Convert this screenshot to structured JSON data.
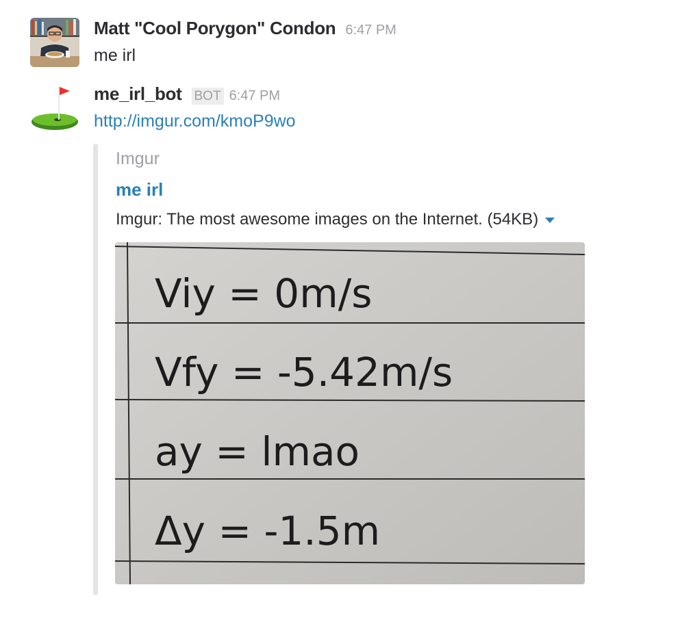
{
  "messages": [
    {
      "sender": "Matt \"Cool Porygon\" Condon",
      "timestamp": "6:47 PM",
      "text": "me irl",
      "avatar": "person-photo-avatar"
    },
    {
      "sender": "me_irl_bot",
      "badge": "BOT",
      "timestamp": "6:47 PM",
      "link": "http://imgur.com/kmoP9wo",
      "avatar": "golf-flag-avatar",
      "attachment": {
        "service_name": "Imgur",
        "title": "me irl",
        "description": "Imgur: The most awesome images on the Internet. (54KB)",
        "expand_icon": "caret-down-icon",
        "image": {
          "lines": [
            "Viy = 0m/s",
            "Vfy = -5.42m/s",
            "ay = lmao",
            "Δy = -1.5m"
          ]
        }
      }
    }
  ],
  "colors": {
    "link": "#2a80b9",
    "muted": "#9e9ea6",
    "text": "#2c2d30",
    "attachment_bar": "#e3e4e6"
  }
}
